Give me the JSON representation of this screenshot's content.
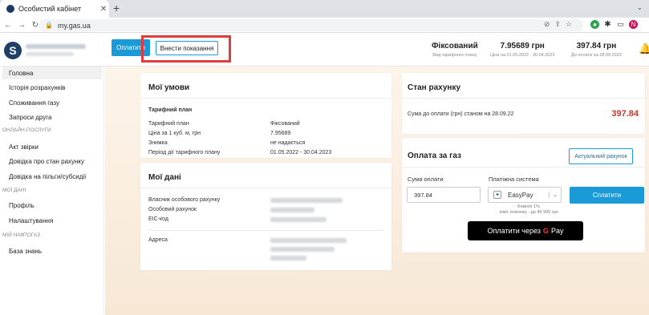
{
  "browser": {
    "tab_title": "Особистий кабінет",
    "new_tab": "+",
    "close": "✕",
    "url": "my.gas.ua",
    "profile_letter": "N"
  },
  "header": {
    "pay_label": "Оплатити",
    "readings_label": "Внести показання",
    "stats": [
      {
        "value": "Фіксований",
        "label": "Вид тарифного плану"
      },
      {
        "value": "7.95689 грн",
        "label": "Ціна на 01.05.2022 - 30.04.2023"
      },
      {
        "value": "397.84 грн",
        "label": "До оплати на 28.09.2022"
      }
    ]
  },
  "sidebar": {
    "items": [
      "Головна",
      "Історія розрахунків",
      "Споживання газу",
      "Запроси друга"
    ],
    "section1": "ОНЛАЙН-ПОСЛУГИ",
    "section1_items": [
      "Акт звірки",
      "Довідка про стан рахунку",
      "Довідка на пільги/субсидії"
    ],
    "section2": "МОЇ ДАНІ",
    "section2_items": [
      "Профіль",
      "Налаштування"
    ],
    "section3": "МІЙ НАФТОГАЗ",
    "section3_items": [
      "База знань"
    ]
  },
  "conditions": {
    "title": "Мої умови",
    "subtitle": "Тарифний план",
    "rows": [
      {
        "label": "Тарифний план",
        "value": "Фіксований"
      },
      {
        "label": "Ціна за 1 куб. м, грн",
        "value": "7.95689"
      },
      {
        "label": "Знижка",
        "value": "не надається"
      },
      {
        "label": "Період дії тарифного плану",
        "value": "01.05.2022 - 30.04.2023"
      }
    ]
  },
  "mydata": {
    "title": "Мої дані",
    "labels": [
      "Власник особового рахунку",
      "Особовий рахунок",
      "EIC-код"
    ],
    "address_label": "Адреса"
  },
  "account": {
    "title": "Стан рахунку",
    "label": "Сума до оплати (грн) станом на 28.09.22",
    "amount": "397.84"
  },
  "payment": {
    "title": "Оплата за газ",
    "actual_btn": "Актуальний рахунок",
    "amount_label": "Сума оплати",
    "amount_value": "397.84",
    "system_label": "Платіжна система",
    "system_value": "EasyPay",
    "fee_line1": "Комісія 1%",
    "fee_line2": "ліміт платежу - до 49 999 грн",
    "pay_btn": "Сплатити",
    "gpay_prefix": "Оплатити через",
    "gpay_g": "G",
    "gpay_pay": "Pay"
  }
}
